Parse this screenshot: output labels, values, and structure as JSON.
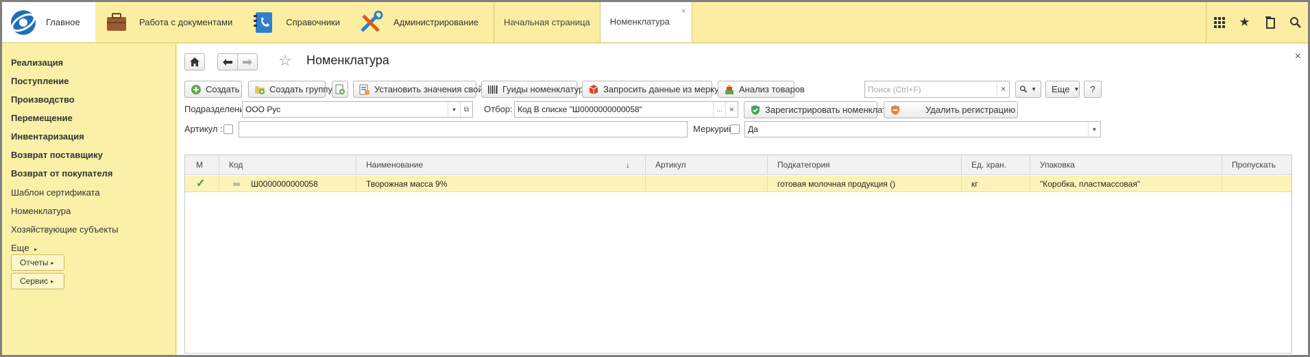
{
  "topbar": {
    "sections": [
      {
        "label": "Главное",
        "icon": "app-logo-icon"
      },
      {
        "label": "Работа с документами",
        "icon": "briefcase-icon"
      },
      {
        "label": "Справочники",
        "icon": "phonebook-icon"
      },
      {
        "label": "Администрирование",
        "icon": "tools-icon"
      }
    ],
    "open_tabs": [
      {
        "label": "Начальная страница"
      },
      {
        "label": "Номенклатура",
        "close": "×"
      }
    ],
    "right_icons": [
      "apps-grid-icon",
      "star-icon",
      "history-icon",
      "search-icon"
    ]
  },
  "sidebar": {
    "items": [
      {
        "label": "Реализация",
        "bold": true
      },
      {
        "label": "Поступление",
        "bold": true
      },
      {
        "label": "Производство",
        "bold": true
      },
      {
        "label": "Перемещение",
        "bold": true
      },
      {
        "label": "Инвентаризация",
        "bold": true
      },
      {
        "label": "Возврат поставщику",
        "bold": true
      },
      {
        "label": "Возврат от покупателя",
        "bold": true
      },
      {
        "label": "Шаблон сертификата",
        "bold": false
      },
      {
        "label": "Номенклатура",
        "bold": false
      },
      {
        "label": "Хозяйствующие субъекты",
        "bold": false
      },
      {
        "label": "Еще",
        "bold": false
      }
    ],
    "more_arrow": "▸",
    "buttons": [
      {
        "label": "Отчеты"
      },
      {
        "label": "Сервис"
      }
    ]
  },
  "form": {
    "title": "Номенклатура",
    "close": "×",
    "toolbar": {
      "create": "Создать",
      "create_group": "Создать группу",
      "set_properties": "Установить значения свойств",
      "guids": "Гуиды номенклатуры",
      "request_mercury": "Запросить данные из меркурий",
      "analysis": "Анализ товаров",
      "more": "Еще",
      "help": "?"
    },
    "search": {
      "placeholder": "Поиск (Ctrl+F)"
    },
    "filters": {
      "division_label": "Подразделение:",
      "division_value": "ООО Рус",
      "filter_label": "Отбор:",
      "filter_value": "Код В списке \"Ш0000000000058\"",
      "register_button": "Зарегистрировать номенклатуру",
      "unregister_button": "Удалить регистрацию",
      "article_label": "Артикул :",
      "mercury_label": "Меркурий:",
      "mercury_value": "Да"
    },
    "table": {
      "columns": [
        "М",
        "Код",
        "Наименование",
        "Артикул",
        "Подкатегория",
        "Ед. хран.",
        "Упаковка",
        "Пропускать"
      ],
      "sort_indicator": "↓",
      "rows": [
        {
          "mark": "✓",
          "code": "Ш0000000000058",
          "name": "Творожная масса 9%",
          "article": "",
          "subcategory": "готовая молочная продукция ()",
          "unit": "кг",
          "package": "\"Коробка, пластмассовая\"",
          "skip": ""
        }
      ]
    }
  }
}
